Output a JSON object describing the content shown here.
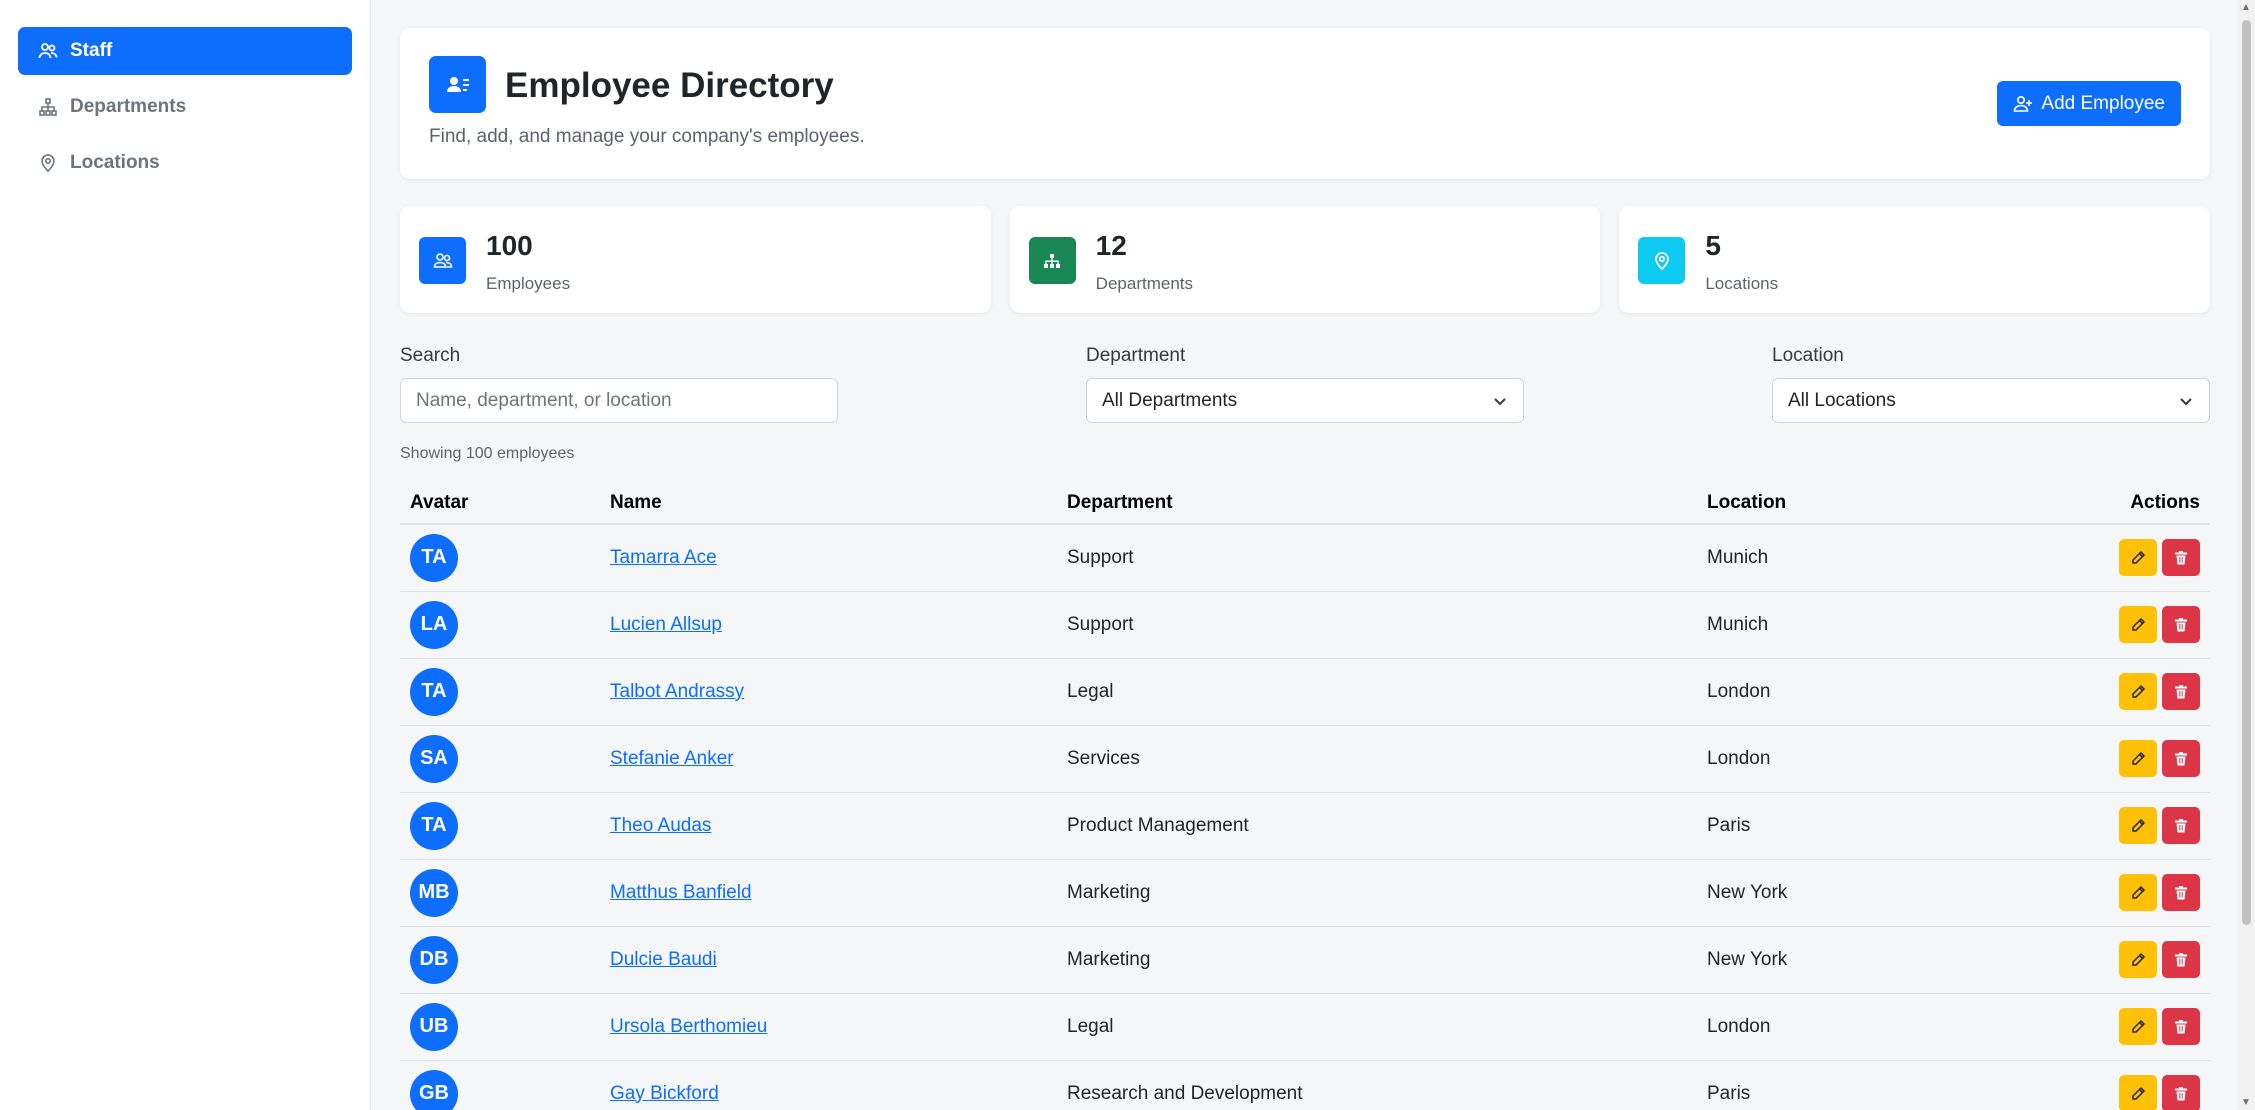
{
  "sidebar": {
    "items": [
      {
        "label": "Staff",
        "icon": "people-icon",
        "active": true
      },
      {
        "label": "Departments",
        "icon": "diagram-icon",
        "active": false
      },
      {
        "label": "Locations",
        "icon": "pin-icon",
        "active": false
      }
    ]
  },
  "header": {
    "title": "Employee Directory",
    "subtitle": "Find, add, and manage your company's employees.",
    "add_label": "Add Employee"
  },
  "stats": [
    {
      "value": "100",
      "label": "Employees",
      "color": "#0d6efd",
      "icon": "people-icon"
    },
    {
      "value": "12",
      "label": "Departments",
      "color": "#198754",
      "icon": "diagram-icon"
    },
    {
      "value": "5",
      "label": "Locations",
      "color": "#0dcaf0",
      "icon": "pin-icon"
    }
  ],
  "filters": {
    "search_label": "Search",
    "search_placeholder": "Name, department, or location",
    "department_label": "Department",
    "department_value": "All Departments",
    "location_label": "Location",
    "location_value": "All Locations"
  },
  "showing": "Showing 100 employees",
  "table": {
    "headers": [
      "Avatar",
      "Name",
      "Department",
      "Location",
      "Actions"
    ],
    "rows": [
      {
        "initials": "TA",
        "name": "Tamarra Ace",
        "department": "Support",
        "location": "Munich"
      },
      {
        "initials": "LA",
        "name": "Lucien Allsup",
        "department": "Support",
        "location": "Munich"
      },
      {
        "initials": "TA",
        "name": "Talbot Andrassy",
        "department": "Legal",
        "location": "London"
      },
      {
        "initials": "SA",
        "name": "Stefanie Anker",
        "department": "Services",
        "location": "London"
      },
      {
        "initials": "TA",
        "name": "Theo Audas",
        "department": "Product Management",
        "location": "Paris"
      },
      {
        "initials": "MB",
        "name": "Matthus Banfield",
        "department": "Marketing",
        "location": "New York"
      },
      {
        "initials": "DB",
        "name": "Dulcie Baudi",
        "department": "Marketing",
        "location": "New York"
      },
      {
        "initials": "UB",
        "name": "Ursola Berthomieu",
        "department": "Legal",
        "location": "London"
      },
      {
        "initials": "GB",
        "name": "Gay Bickford",
        "department": "Research and Development",
        "location": "Paris"
      }
    ]
  }
}
